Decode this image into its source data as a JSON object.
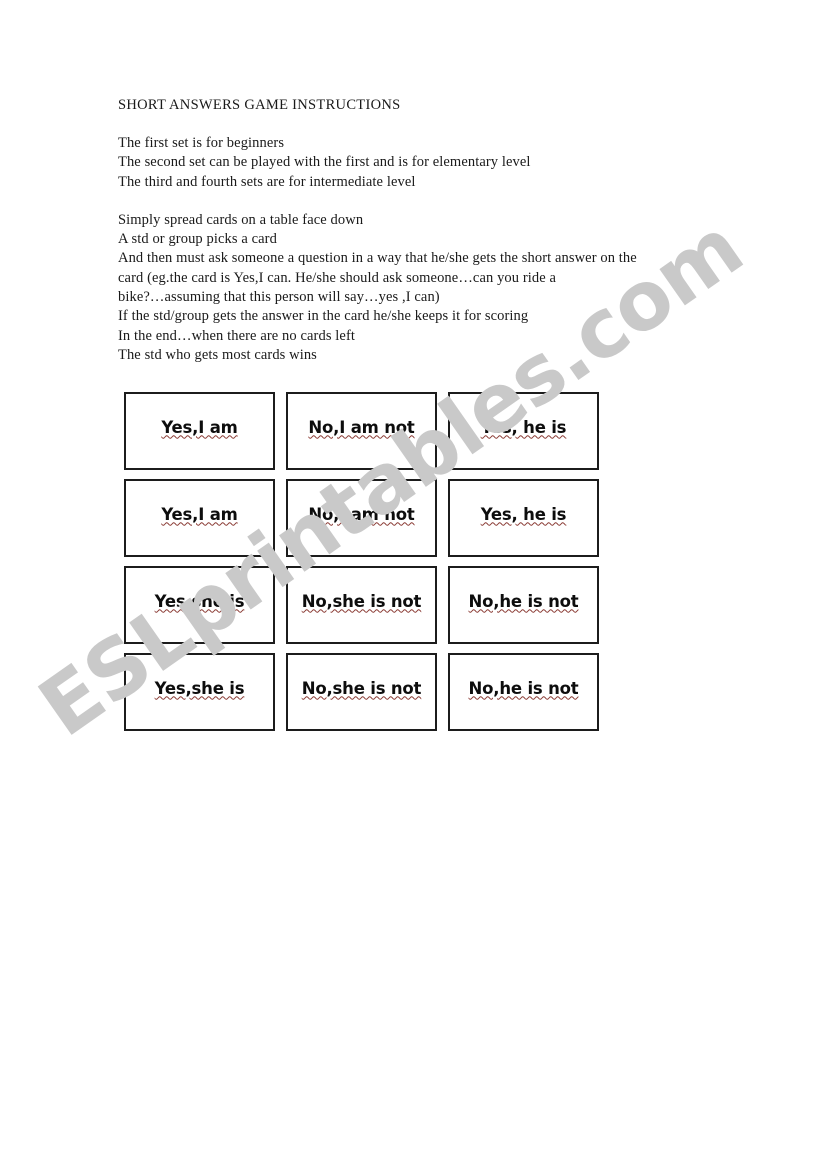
{
  "document": {
    "title": "SHORT ANSWERS GAME INSTRUCTIONS",
    "paragraph_1": [
      "The first set is for beginners",
      "The second set can be played with the first and is for elementary level",
      "The third and fourth sets are for intermediate level"
    ],
    "paragraph_2": [
      "Simply spread cards on a table face down",
      "A std or group picks a card",
      "And then must ask someone a question in a way that he/she gets the short answer on the",
      "card (eg.the card is Yes,I can. He/she should ask someone…can you ride a",
      "bike?…assuming that this person will say…yes ,I can)",
      "If the std/group gets the answer in the card he/she keeps it for scoring",
      "In the end…when there are no cards left",
      "The std who gets most cards wins"
    ]
  },
  "cards": {
    "rows": [
      {
        "cells": [
          "Yes,I am",
          "No,I am not",
          "Yes, he is"
        ]
      },
      {
        "cells": [
          "Yes,I am",
          "No,I am not",
          "Yes, he is"
        ]
      },
      {
        "cells": [
          "Yes,she is",
          "No,she is not",
          "No,he is not"
        ]
      },
      {
        "cells": [
          "Yes,she is",
          "No,she is not",
          "No,he is not"
        ]
      }
    ]
  },
  "watermark": {
    "text": "ESLprintables.com",
    "color": "#c9c9c9"
  },
  "colors": {
    "text": "#1a1a1a",
    "card_border": "#1c1c1c",
    "spellcheck_underline": "#8a3b34",
    "page_background": "#ffffff"
  }
}
